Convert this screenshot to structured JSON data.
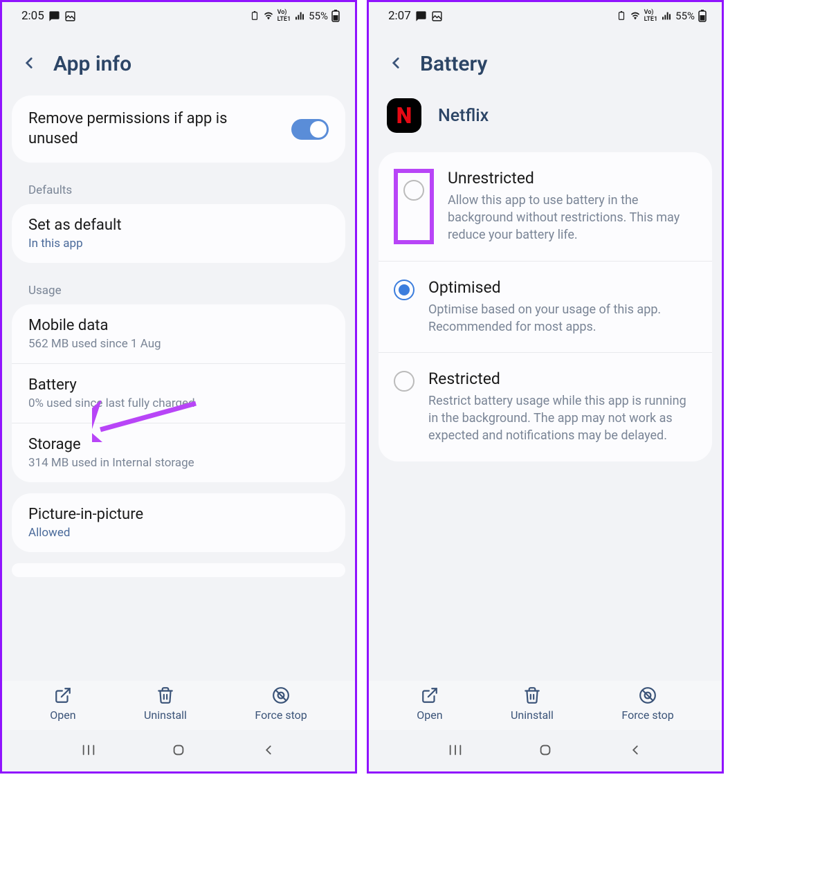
{
  "left": {
    "status": {
      "time": "2:05",
      "battery": "55%"
    },
    "header": {
      "title": "App info"
    },
    "perm_toggle": {
      "label": "Remove permissions if app is unused"
    },
    "section_defaults": "Defaults",
    "default_item": {
      "title": "Set as default",
      "sub": "In this app"
    },
    "section_usage": "Usage",
    "usage_items": [
      {
        "title": "Mobile data",
        "sub": "562 MB used since 1 Aug"
      },
      {
        "title": "Battery",
        "sub": "0% used since last fully charged"
      },
      {
        "title": "Storage",
        "sub": "314 MB used in Internal storage"
      }
    ],
    "pip_item": {
      "title": "Picture-in-picture",
      "sub": "Allowed"
    },
    "bottom": {
      "open": "Open",
      "uninstall": "Uninstall",
      "force_stop": "Force stop"
    }
  },
  "right": {
    "status": {
      "time": "2:07",
      "battery": "55%"
    },
    "header": {
      "title": "Battery"
    },
    "app": {
      "name": "Netflix"
    },
    "options": [
      {
        "title": "Unrestricted",
        "desc": "Allow this app to use battery in the background without restrictions. This may reduce your battery life."
      },
      {
        "title": "Optimised",
        "desc": "Optimise based on your usage of this app. Recommended for most apps."
      },
      {
        "title": "Restricted",
        "desc": "Restrict battery usage while this app is running in the background. The app may not work as expected and notifications may be delayed."
      }
    ],
    "bottom": {
      "open": "Open",
      "uninstall": "Uninstall",
      "force_stop": "Force stop"
    }
  }
}
